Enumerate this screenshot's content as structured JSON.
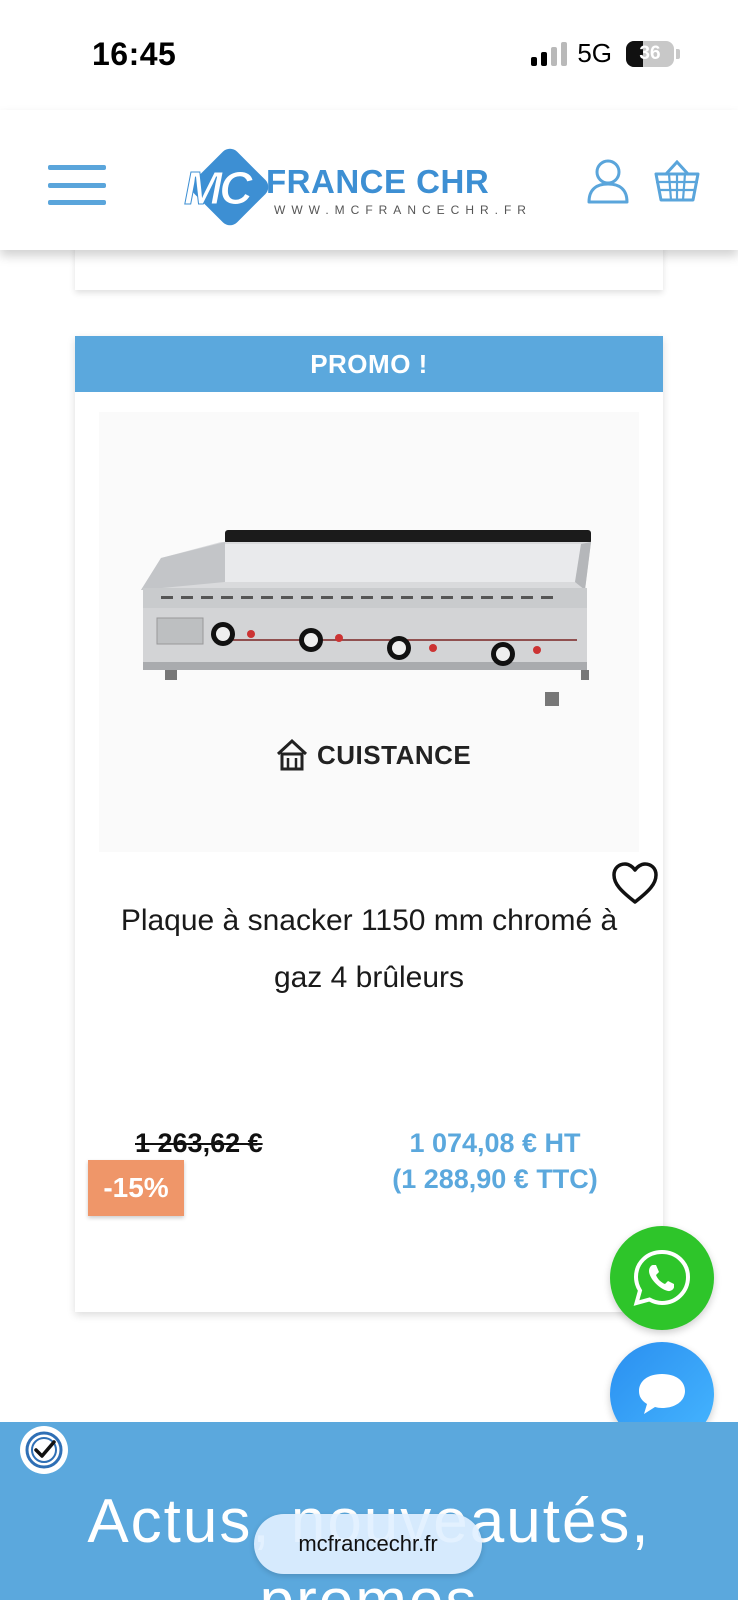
{
  "status_bar": {
    "time": "16:45",
    "network": "5G",
    "battery": "36"
  },
  "header": {
    "logo_mark": "MC",
    "logo_name": "FRANCE CHR",
    "logo_url": "WWW.MCFRANCECHR.FR"
  },
  "product": {
    "badge": "PROMO !",
    "brand": "CUISTANCE",
    "title": "Plaque à snacker 1150 mm chromé à gaz 4 brûleurs",
    "old_price": "1 263,62 €",
    "discount": "-15%",
    "price_ht": "1 074,08 € HT",
    "price_ttc": "(1 288,90 € TTC)"
  },
  "footer": {
    "heading": "Actus, nouveautés, promos"
  },
  "browser": {
    "url": "mcfrancechr.fr"
  },
  "colors": {
    "accent": "#5ba8dd",
    "discount": "#ef9669",
    "whatsapp": "#2ec52a",
    "chat": "#2a8ff0"
  }
}
